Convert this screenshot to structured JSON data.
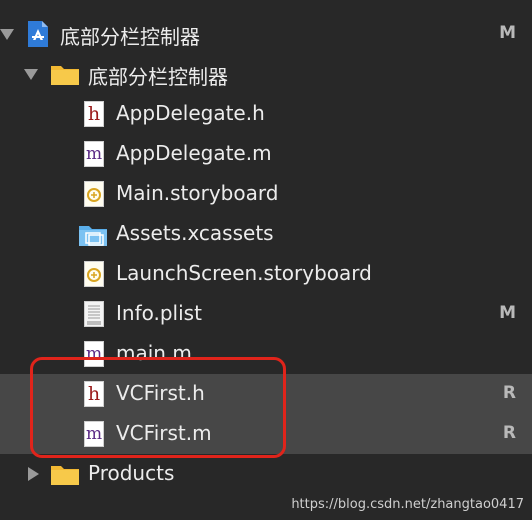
{
  "navigator": {
    "project": {
      "label": "底部分栏控制器",
      "badge": "M",
      "icon": "xcode-project-icon"
    },
    "group": {
      "label": "底部分栏控制器",
      "icon": "folder-icon"
    },
    "files": [
      {
        "label": "AppDelegate.h",
        "badge": "",
        "icon": "header-file-icon"
      },
      {
        "label": "AppDelegate.m",
        "badge": "",
        "icon": "implementation-file-icon"
      },
      {
        "label": "Main.storyboard",
        "badge": "",
        "icon": "storyboard-icon"
      },
      {
        "label": "Assets.xcassets",
        "badge": "",
        "icon": "asset-catalog-icon"
      },
      {
        "label": "LaunchScreen.storyboard",
        "badge": "",
        "icon": "storyboard-icon"
      },
      {
        "label": "Info.plist",
        "badge": "M",
        "icon": "plist-icon"
      },
      {
        "label": "main.m",
        "badge": "",
        "icon": "implementation-file-icon"
      },
      {
        "label": "VCFirst.h",
        "badge": "R",
        "icon": "header-file-icon"
      },
      {
        "label": "VCFirst.m",
        "badge": "R",
        "icon": "implementation-file-icon"
      }
    ],
    "products": {
      "label": "Products",
      "icon": "folder-icon"
    }
  },
  "watermark": "https://blog.csdn.net/zhangtao0417",
  "colors": {
    "background": "#282828",
    "selection": "#474747",
    "highlight": "#e0241b"
  }
}
